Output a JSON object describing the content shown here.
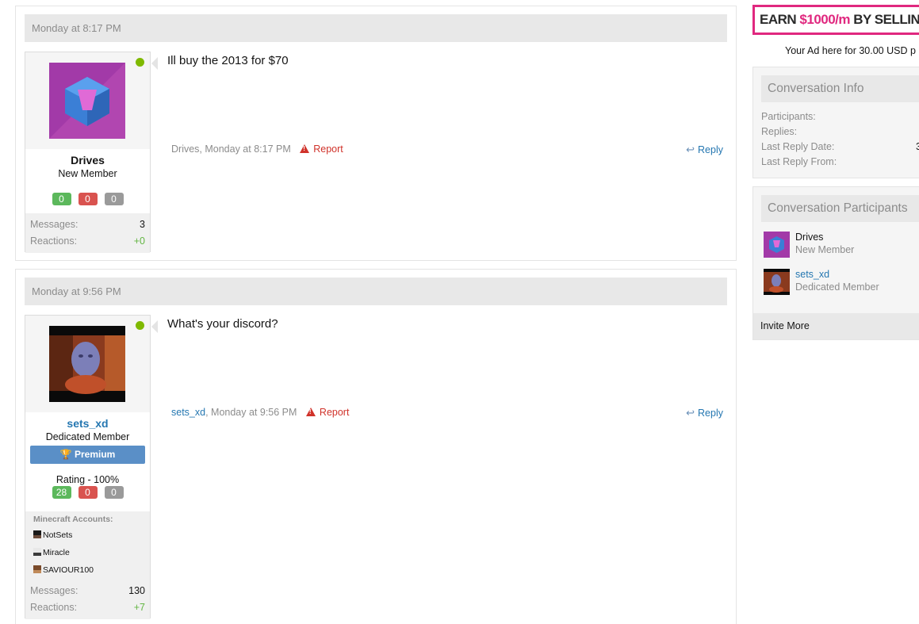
{
  "posts": [
    {
      "date": "Monday at 8:17 PM",
      "user": {
        "name": "Drives",
        "title": "New Member",
        "rep": [
          "0",
          "0",
          "0"
        ],
        "stats": [
          {
            "label": "Messages:",
            "value": "3"
          },
          {
            "label": "Reactions:",
            "value": "+0"
          }
        ]
      },
      "message": "Ill buy the 2013 for $70",
      "meta_author": "Drives",
      "meta_time": ", Monday at 8:17 PM",
      "report_label": "Report",
      "reply_label": "Reply"
    },
    {
      "date": "Monday at 9:56 PM",
      "user": {
        "name": "sets_xd",
        "title": "Dedicated Member",
        "badge": "Premium",
        "rating": "Rating - 100%",
        "rep": [
          "28",
          "0",
          "0"
        ],
        "mc_title": "Minecraft Accounts:",
        "mc_accounts": [
          "NotSets",
          "Miracle",
          "SAVIOUR100"
        ],
        "stats": [
          {
            "label": "Messages:",
            "value": "130"
          },
          {
            "label": "Reactions:",
            "value": "+7"
          }
        ]
      },
      "message": "What's your discord?",
      "meta_author": "sets_xd",
      "meta_time": ", Monday at 9:56 PM",
      "report_label": "Report",
      "reply_label": "Reply"
    }
  ],
  "sidebar": {
    "ad_banner": {
      "prefix": "EARN ",
      "accent": "$1000/m",
      "suffix": " BY SELLING"
    },
    "ad_text": "Your Ad here for 30.00 USD p",
    "conversation_info": {
      "title": "Conversation Info",
      "rows": [
        {
          "label": "Participants:",
          "value": ""
        },
        {
          "label": "Replies:",
          "value": ""
        },
        {
          "label": "Last Reply Date:",
          "value": "3"
        },
        {
          "label": "Last Reply From:",
          "value": ""
        }
      ]
    },
    "participants": {
      "title": "Conversation Participants",
      "items": [
        {
          "name": "Drives",
          "title": "New Member"
        },
        {
          "name": "sets_xd",
          "title": "Dedicated Member"
        }
      ],
      "invite_label": "Invite More"
    }
  },
  "colors": {
    "accent_link": "#2577b1",
    "online": "#7fb900",
    "rep_positive": "#5cb85c",
    "rep_negative": "#d9534f",
    "rep_neutral": "#9a9a9a",
    "premium": "#5a8fc7",
    "report": "#d0322a",
    "ad_accent": "#e0287f"
  }
}
